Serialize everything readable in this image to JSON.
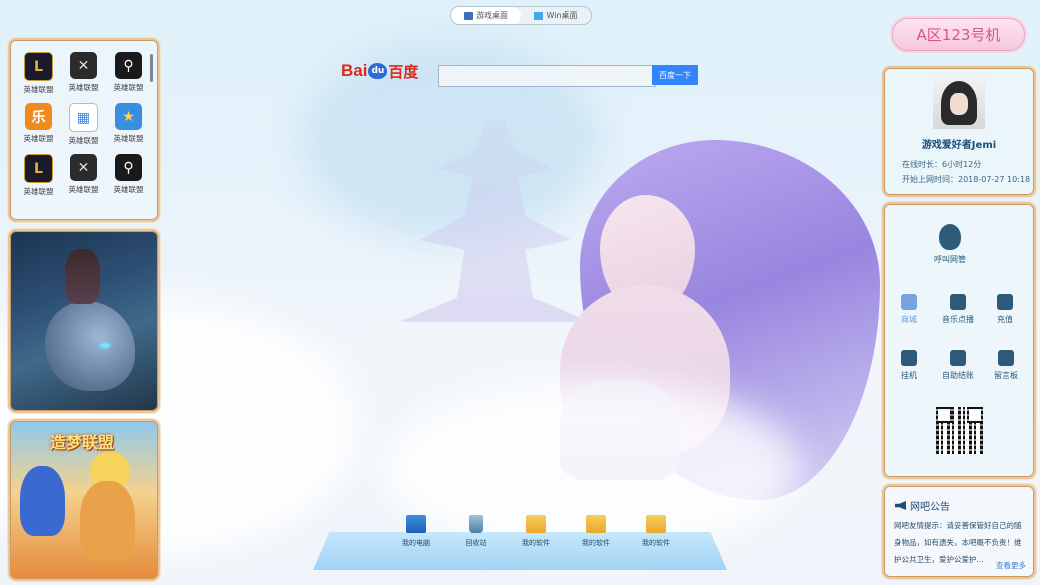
{
  "top_switch": {
    "options": [
      "游戏桌面",
      "Win桌面"
    ],
    "active": "游戏桌面"
  },
  "search": {
    "logo_text_1": "Bai",
    "logo_text_2": "du",
    "logo_text_3": "百度",
    "button_label": "百度一下",
    "placeholder": ""
  },
  "apps": [
    {
      "label": "英雄联盟",
      "icon": "lol-icon"
    },
    {
      "label": "英雄联盟",
      "icon": "crossfire-icon"
    },
    {
      "label": "英雄联盟",
      "icon": "counter-strike-icon"
    },
    {
      "label": "英雄联盟",
      "icon": "fun-game-icon"
    },
    {
      "label": "英雄联盟",
      "icon": "shop-icon"
    },
    {
      "label": "英雄联盟",
      "icon": "toy-game-icon"
    },
    {
      "label": "英雄联盟",
      "icon": "lol-icon"
    },
    {
      "label": "英雄联盟",
      "icon": "crossfire-icon"
    },
    {
      "label": "英雄联盟",
      "icon": "counter-strike-icon"
    }
  ],
  "banners": {
    "game_ad_2_logo": "造梦联盟"
  },
  "account": {
    "machine": "A区123号机"
  },
  "profile": {
    "nickname": "游戏爱好者Jemi",
    "online_label": "在线时长：6小时12分",
    "start_label": "开始上网时间：2018-07-27 10:18"
  },
  "tools": {
    "call_admin": "呼叫网管",
    "items": [
      "商城",
      "音乐点播",
      "充值",
      "挂机",
      "自助结账",
      "留言板"
    ]
  },
  "notice": {
    "title": "网吧公告",
    "text": "网吧友情提示：请妥善保管好自己的随身物品，如有遗失，本吧概不负责！维护公共卫生，爱护公爱护...",
    "more": "查看更多"
  },
  "dock": {
    "items": [
      {
        "label": "我的电脑",
        "icon": "computer-icon"
      },
      {
        "label": "回收站",
        "icon": "recycle-bin-icon"
      },
      {
        "label": "我的软件",
        "icon": "folder-icon"
      },
      {
        "label": "我的软件",
        "icon": "folder-icon"
      },
      {
        "label": "我的软件",
        "icon": "folder-icon"
      }
    ]
  },
  "colors": {
    "accent_pink": "#d85493",
    "baidu_red": "#de2a1d",
    "baidu_blue": "#3385ff",
    "frame_gold": "#e7c79e"
  }
}
